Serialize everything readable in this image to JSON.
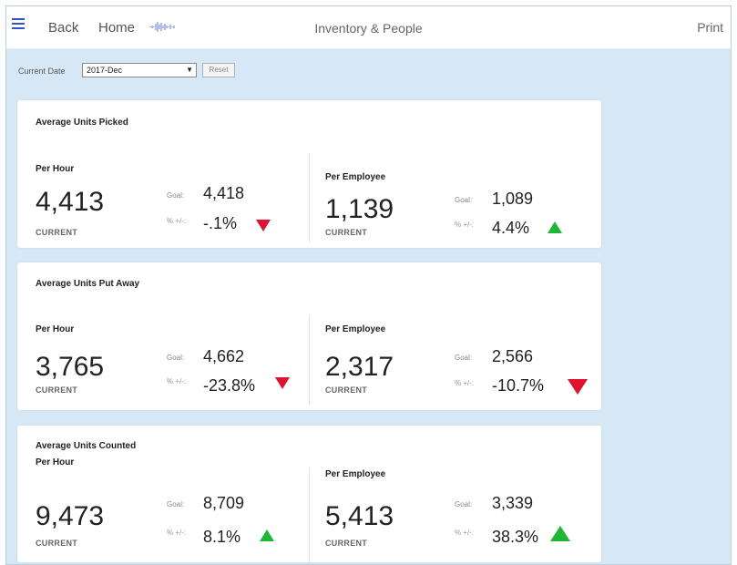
{
  "header": {
    "back_label": "Back",
    "home_label": "Home",
    "title": "Inventory & People",
    "print_label": "Print"
  },
  "filters": {
    "date_label": "Current Date",
    "date_value": "2017-Dec",
    "reset_label": "Reset"
  },
  "colors": {
    "up": "#1db733",
    "down": "#e0102e",
    "accent": "#2b56c9"
  },
  "labels": {
    "per_hour": "Per Hour",
    "per_employee": "Per Employee",
    "current": "CURRENT",
    "goal": "Goal:",
    "pct": "% +/-:"
  },
  "cards": [
    {
      "title": "Average Units Picked",
      "per_hour": {
        "current": "4,413",
        "goal": "4,418",
        "pct": "-.1%",
        "trend": "down"
      },
      "per_employee": {
        "current": "1,139",
        "goal": "1,089",
        "pct": "4.4%",
        "trend": "up"
      }
    },
    {
      "title": "Average Units Put Away",
      "per_hour": {
        "current": "3,765",
        "goal": "4,662",
        "pct": "-23.8%",
        "trend": "down"
      },
      "per_employee": {
        "current": "2,317",
        "goal": "2,566",
        "pct": "-10.7%",
        "trend": "down"
      }
    },
    {
      "title": "Average Units Counted",
      "per_hour": {
        "current": "9,473",
        "goal": "8,709",
        "pct": "8.1%",
        "trend": "up"
      },
      "per_employee": {
        "current": "5,413",
        "goal": "3,339",
        "pct": "38.3%",
        "trend": "up"
      }
    }
  ]
}
